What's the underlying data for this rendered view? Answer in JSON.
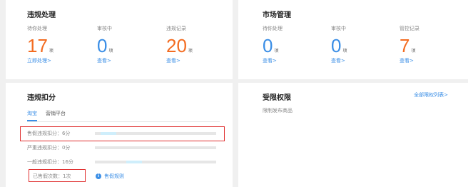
{
  "violation": {
    "title": "违规处理",
    "stats": [
      {
        "label": "待你处理",
        "value": "17",
        "unit": "项",
        "link": "立即处理>",
        "color": "#f36c21"
      },
      {
        "label": "审核中",
        "value": "0",
        "unit": "项",
        "link": "查看>",
        "color": "#3a8ee6"
      },
      {
        "label": "违规记录",
        "value": "20",
        "unit": "项",
        "link": "查看>",
        "color": "#f36c21"
      }
    ]
  },
  "market": {
    "title": "市场管理",
    "stats": [
      {
        "label": "待你处理",
        "value": "0",
        "unit": "项",
        "link": "查看>",
        "color": "#3a8ee6"
      },
      {
        "label": "审核中",
        "value": "0",
        "unit": "项",
        "link": "查看>",
        "color": "#3a8ee6"
      },
      {
        "label": "管控记录",
        "value": "7",
        "unit": "项",
        "link": "查看>",
        "color": "#f36c21"
      }
    ]
  },
  "deduct": {
    "title": "违规扣分",
    "tabs": [
      "淘宝",
      "营销平台"
    ],
    "active_tab": 0,
    "rows": [
      {
        "label": "售假违规扣分：6分",
        "progress": 0.13
      },
      {
        "label": "严重违规扣分：0分",
        "progress": 0
      },
      {
        "label": "一般违规扣分：16分",
        "progress": 0.13
      }
    ],
    "sold_fake_count": "已售假次数：1次",
    "rules_link": "售假规则",
    "info_icon": "i"
  },
  "limits": {
    "title": "受限权限",
    "all_link": "全部限权列表>",
    "item": "限制发布商品"
  },
  "colors": {
    "accent": "#3a8ee6",
    "orange": "#f36c21",
    "highlight": "#e03030"
  }
}
